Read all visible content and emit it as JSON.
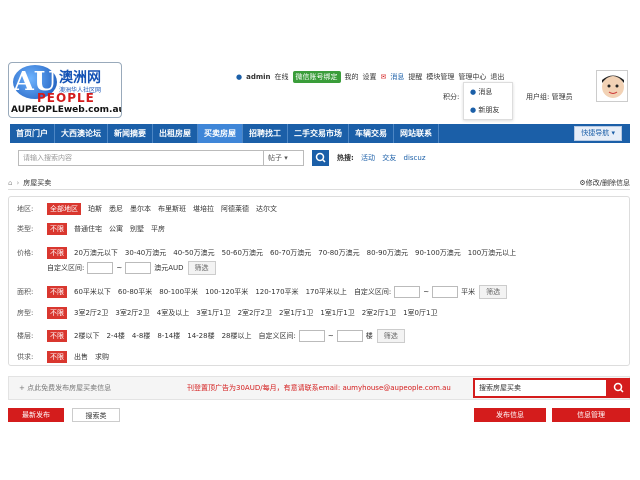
{
  "logo": {
    "chinese": "澳洲网",
    "sub": "澳洲华人社区网",
    "people": "PEOPLE",
    "url": "AUPEOPLEweb.com.au",
    "au": "AU"
  },
  "userbar": {
    "username": "admin",
    "online": "在线",
    "wechat": "微信账号绑定",
    "mine": "我的",
    "settings": "设置",
    "messages": "消息",
    "reminders": "提醒",
    "module_manage": "模块管理",
    "admin_center": "管理中心",
    "logout": "退出",
    "points_label": "积分:",
    "group_label": "用户组: 管理员"
  },
  "dropdown": {
    "messages": "消息",
    "new_friends": "新朋友"
  },
  "nav": {
    "items": [
      "首页门户",
      "大西澳论坛",
      "新闻摘要",
      "出租房屋",
      "买卖房屋",
      "招聘找工",
      "二手交易市场",
      "车辆交易",
      "网站联系"
    ],
    "active_index": 4,
    "quick": "快捷导航"
  },
  "search": {
    "placeholder": "请输入搜索内容",
    "scope": "帖子",
    "hot_label": "热搜:",
    "hot_links": [
      "活动",
      "交友",
      "discuz"
    ]
  },
  "breadcrumb": {
    "current": "房屋买卖",
    "right": "修改/删除信息"
  },
  "filters": {
    "region": {
      "label": "地区:",
      "options": [
        "全部地区",
        "珀斯",
        "悉尼",
        "墨尔本",
        "布里斯班",
        "堪培拉",
        "阿德莱德",
        "达尔文"
      ]
    },
    "type": {
      "label": "类型:",
      "options": [
        "不限",
        "普通住宅",
        "公寓",
        "别墅",
        "平房"
      ]
    },
    "price": {
      "label": "价格:",
      "options": [
        "不限",
        "20万澳元以下",
        "30-40万澳元",
        "40-50万澳元",
        "50-60万澳元",
        "60-70万澳元",
        "70-80万澳元",
        "80-90万澳元",
        "90-100万澳元",
        "100万澳元以上"
      ],
      "custom": "自定义区间:",
      "unit": "澳元AUD",
      "button": "筛选"
    },
    "area": {
      "label": "面积:",
      "options": [
        "不限",
        "60平米以下",
        "60-80平米",
        "80-100平米",
        "100-120平米",
        "120-170平米",
        "170平米以上"
      ],
      "custom": "自定义区间:",
      "unit": "平米",
      "button": "筛选"
    },
    "rooms": {
      "label": "房型:",
      "options": [
        "不限",
        "3室2厅2卫",
        "3室2厅2卫",
        "4室及以上",
        "3室1厅1卫",
        "2室2厅2卫",
        "2室1厅1卫",
        "1室1厅1卫",
        "2室2厅1卫",
        "1室0厅1卫"
      ]
    },
    "floor": {
      "label": "楼层:",
      "options": [
        "不限",
        "2楼以下",
        "2-4楼",
        "4-8楼",
        "8-14楼",
        "14-28楼",
        "28楼以上"
      ],
      "custom": "自定义区间:",
      "unit": "楼",
      "button": "筛选"
    },
    "supply": {
      "label": "供求:",
      "options": [
        "不限",
        "出售",
        "求购"
      ]
    }
  },
  "bottom": {
    "post": "+ 点此免费发布房屋买卖信息",
    "ad": "刊登置顶广告为30AUD/每月，有意请联系email: aumyhouse@aupeople.com.au",
    "search_value": "搜索房屋买卖",
    "publish": "发布信息",
    "manage": "信息管理",
    "latest": "最新发布",
    "filter": "搜索类"
  },
  "colors": {
    "nav_blue": "#1b5fa8",
    "active_blue": "#3f86d8",
    "accent_red": "#d41c1c"
  }
}
